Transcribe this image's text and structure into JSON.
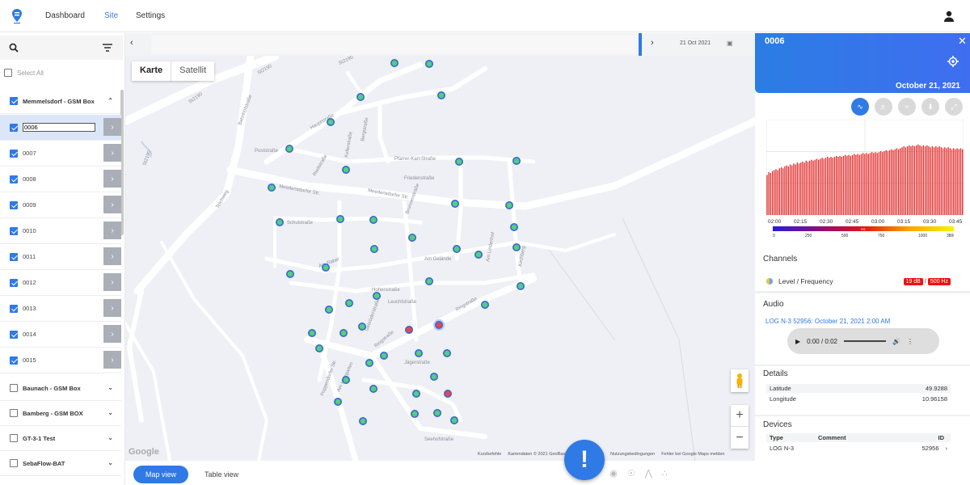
{
  "nav": {
    "dashboard": "Dashboard",
    "site": "Site",
    "settings": "Settings"
  },
  "left": {
    "select_all": "Select All",
    "groups_top": {
      "label": "Memmelsdorf - GSM Box"
    },
    "items": [
      {
        "label": "0006",
        "selected": true
      },
      {
        "label": "0007"
      },
      {
        "label": "0008"
      },
      {
        "label": "0009"
      },
      {
        "label": "0010"
      },
      {
        "label": "0011"
      },
      {
        "label": "0012"
      },
      {
        "label": "0013"
      },
      {
        "label": "0014"
      },
      {
        "label": "0015"
      }
    ],
    "groups_bottom": [
      {
        "label": "Baunach - GSM Box"
      },
      {
        "label": "Bamberg - GSM BOX"
      },
      {
        "label": "GT-3-1 Test"
      },
      {
        "label": "SebaFlow-BAT"
      }
    ]
  },
  "timeline": {
    "date": "21 Oct 2021"
  },
  "map": {
    "type_map": "Karte",
    "type_satellite": "Satellit",
    "google": "Google",
    "attribution": [
      "Kurzbefehle",
      "Kartendaten © 2021 GeoBasis-DE/BKG (©2009)",
      "Nutzungsbedingungen",
      "Fehler bei Google Maps melden"
    ],
    "streets": [
      "St2190",
      "St2190",
      "St2190",
      "St2190",
      "Bahnhofstraße",
      "Hauptstraße",
      "Poststraße",
      "Meedensdorfer Str.",
      "Meedensdorfer Str.",
      "Ringstraße",
      "Ringstraße",
      "Seehofstraße",
      "Pfarrer-Karl-Straße",
      "Friedenstraße",
      "Kellerstraße",
      "Bergstraße",
      "Schulstraße",
      "Am Rabel",
      "Am Gelände",
      "Leuchtstraße",
      "Gebrüderstraße",
      "Am Holzgarten",
      "Riedstraße",
      "Brunnenstraße",
      "Hohenstraße",
      "Poppendorfer Str.",
      "Am Lindenhof",
      "Teichweg",
      "Kirchberg",
      "Jägerstraße"
    ],
    "markers": [
      {
        "lng": 488,
        "lat": 78
      },
      {
        "lng": 531,
        "lat": 79
      },
      {
        "lng": 446,
        "lat": 120
      },
      {
        "lng": 546,
        "lat": 118
      },
      {
        "lng": 409,
        "lat": 151
      },
      {
        "lng": 358,
        "lat": 184
      },
      {
        "lng": 428,
        "lat": 210
      },
      {
        "lng": 568,
        "lat": 200
      },
      {
        "lng": 639,
        "lat": 199
      },
      {
        "lng": 336,
        "lat": 232
      },
      {
        "lng": 563,
        "lat": 252
      },
      {
        "lng": 630,
        "lat": 254
      },
      {
        "lng": 346,
        "lat": 275
      },
      {
        "lng": 421,
        "lat": 271
      },
      {
        "lng": 462,
        "lat": 272
      },
      {
        "lng": 636,
        "lat": 281
      },
      {
        "lng": 510,
        "lat": 294
      },
      {
        "lng": 463,
        "lat": 308
      },
      {
        "lng": 565,
        "lat": 308
      },
      {
        "lng": 639,
        "lat": 306
      },
      {
        "lng": 592,
        "lat": 315
      },
      {
        "lng": 403,
        "lat": 331
      },
      {
        "lng": 359,
        "lat": 339
      },
      {
        "lng": 531,
        "lat": 348
      },
      {
        "lng": 644,
        "lat": 354
      },
      {
        "lng": 466,
        "lat": 366
      },
      {
        "lng": 432,
        "lat": 375
      },
      {
        "lng": 407,
        "lat": 383
      },
      {
        "lng": 600,
        "lat": 377
      },
      {
        "lng": 386,
        "lat": 412
      },
      {
        "lng": 425,
        "lat": 412
      },
      {
        "lng": 448,
        "lat": 404
      },
      {
        "lng": 395,
        "lat": 431
      },
      {
        "lng": 518,
        "lat": 437
      },
      {
        "lng": 553,
        "lat": 437
      },
      {
        "lng": 457,
        "lat": 449
      },
      {
        "lng": 475,
        "lat": 440
      },
      {
        "lng": 428,
        "lat": 470
      },
      {
        "lng": 537,
        "lat": 466
      },
      {
        "lng": 462,
        "lat": 481
      },
      {
        "lng": 515,
        "lat": 487
      },
      {
        "lng": 418,
        "lat": 497
      },
      {
        "lng": 541,
        "lat": 511
      },
      {
        "lng": 513,
        "lat": 512
      },
      {
        "lng": 449,
        "lat": 521
      },
      {
        "lng": 562,
        "lat": 520
      }
    ],
    "alarm_markers": [
      {
        "lng": 506,
        "lat": 408
      },
      {
        "lng": 543,
        "lat": 402
      },
      {
        "lng": 554,
        "lat": 487
      }
    ]
  },
  "bottom": {
    "map_view": "Map view",
    "table_view": "Table view",
    "alert": "!"
  },
  "panel": {
    "title": "0006",
    "date": "October 21, 2021",
    "chart_data": {
      "type": "bar",
      "x_ticks": [
        "02:00",
        "02:15",
        "02:30",
        "02:45",
        "03:00",
        "03:15",
        "03:30",
        "03:45"
      ],
      "values": [
        42,
        45,
        44,
        46,
        47,
        48,
        47,
        49,
        50,
        49,
        51,
        52,
        51,
        53,
        52,
        54,
        53,
        55,
        54,
        55,
        56,
        55,
        57,
        56,
        57,
        58,
        57,
        58,
        59,
        58,
        59,
        60,
        59,
        60,
        61,
        60,
        61,
        60,
        61,
        62,
        61,
        62,
        61,
        62,
        63,
        62,
        63,
        62,
        63,
        64,
        63,
        64,
        63,
        64,
        65,
        64,
        65,
        64,
        65,
        66,
        65,
        66,
        65,
        66,
        67,
        66,
        67,
        68,
        67,
        68,
        69,
        68,
        69,
        70,
        69,
        70,
        71,
        72,
        71,
        72,
        73,
        72,
        73,
        72,
        73,
        74,
        73,
        72,
        73,
        72,
        73,
        72,
        71,
        72,
        71,
        72,
        71,
        72,
        71,
        70,
        71,
        70,
        71,
        70,
        69,
        70,
        69,
        70,
        69,
        70,
        69
      ],
      "ylim": [
        0,
        100
      ],
      "colorbar_ticks": [
        "0",
        "250",
        "500",
        "750",
        "1000",
        "3800"
      ],
      "colorbar_label": "Hz",
      "bar_color": "#e22a2a"
    },
    "channels_title": "Channels",
    "channel_label": "Level / Frequency",
    "channel_level": "19 dB",
    "channel_freq": "500 Hz",
    "channel_sep": "/",
    "audio_title": "Audio",
    "audio_link": "LOG N-3 52956: October 21, 2021 2:00 AM",
    "audio_time": "0:00 / 0:02",
    "details_title": "Details",
    "details": [
      {
        "label": "Latitude",
        "value": "49.9288"
      },
      {
        "label": "Longitude",
        "value": "10.96158"
      }
    ],
    "devices_title": "Devices",
    "devices_header": {
      "type": "Type",
      "comment": "Comment",
      "id": "ID"
    },
    "devices_row": {
      "type": "LOG N-3",
      "comment": "",
      "id": "52956"
    }
  },
  "colors": {
    "accent": "#2f7ae5",
    "marker_ok": "#4fd07d",
    "marker_alarm": "#e44",
    "bars": "#e22a2a"
  }
}
